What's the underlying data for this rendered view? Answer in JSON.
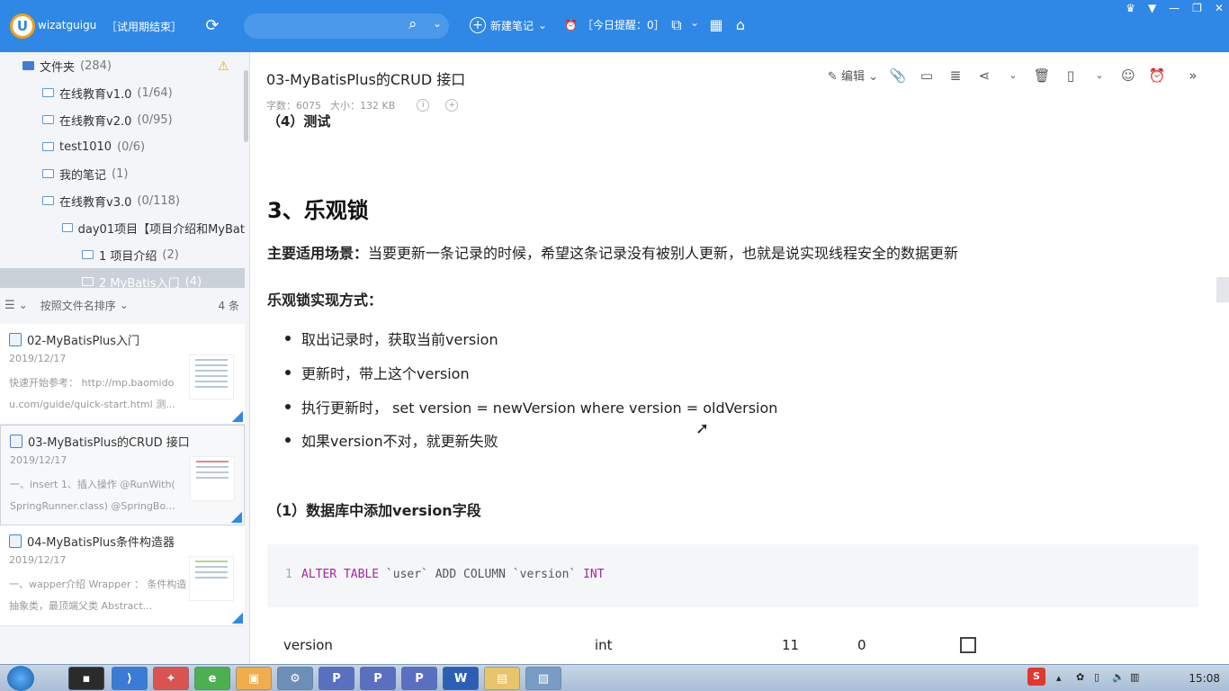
{
  "app": {
    "username": "wizatguigu",
    "trial": "［试用期结束］",
    "new_note": "新建笔记",
    "reminder": "［今日提醒：0］"
  },
  "sidebar": {
    "tree": [
      {
        "label": "文件夹",
        "count": "(284)"
      },
      {
        "label": "在线教育v1.0",
        "count": "(1/64)"
      },
      {
        "label": "在线教育v2.0",
        "count": "(0/95)"
      },
      {
        "label": "test1010",
        "count": "(0/6)"
      },
      {
        "label": "我的笔记",
        "count": "(1)"
      },
      {
        "label": "在线教育v3.0",
        "count": "(0/118)"
      },
      {
        "label": "day01项目【项目介绍和MyBat",
        "count": ""
      },
      {
        "label": "1 项目介绍",
        "count": "(2)"
      },
      {
        "label": "2 MyBatis入门",
        "count": "(4)"
      }
    ],
    "sort_label": "按照文件名排序",
    "item_count": "4 条",
    "notes": [
      {
        "title": "02-MyBatisPlus入门",
        "date": "2019/12/17",
        "snippet": "快速开始参考： http://mp.baomido u.com/guide/quick-start.html 测..."
      },
      {
        "title": "03-MyBatisPlus的CRUD 接口",
        "date": "2019/12/17",
        "snippet": "一、insert 1、插入操作 @RunWith( SpringRunner.class) @SpringBo..."
      },
      {
        "title": "04-MyBatisPlus条件构造器",
        "date": "2019/12/17",
        "snippet": "一、wapper介绍 Wrapper ： 条件构造抽象类，最顶端父类 Abstract..."
      }
    ]
  },
  "editor": {
    "title": "03-MyBatisPlus的CRUD 接口",
    "word_count": "字数：6075",
    "size": "大小：132 KB",
    "edit_label": "编辑"
  },
  "doc": {
    "partial_heading": "（4）测试",
    "h3": "3、乐观锁",
    "scenario_label": "主要适用场景：",
    "scenario_text": "当要更新一条记录的时候，希望这条记录没有被别人更新，也就是说实现线程安全的数据更新",
    "impl_label": "乐观锁实现方式：",
    "bullets": [
      "取出记录时，获取当前version",
      "更新时，带上这个version",
      "执行更新时， set version = newVersion where version = oldVersion",
      "如果version不对，就更新失败"
    ],
    "sub_heading": "（1）数据库中添加version字段",
    "code_line_number": "1",
    "code_kw1": "ALTER TABLE",
    "code_mid": " `user` ADD COLUMN `version` ",
    "code_kw2": "INT",
    "table": {
      "name": "version",
      "type": "int",
      "length": "11",
      "decimal": "0"
    }
  },
  "taskbar": {
    "clock": "15:08"
  }
}
